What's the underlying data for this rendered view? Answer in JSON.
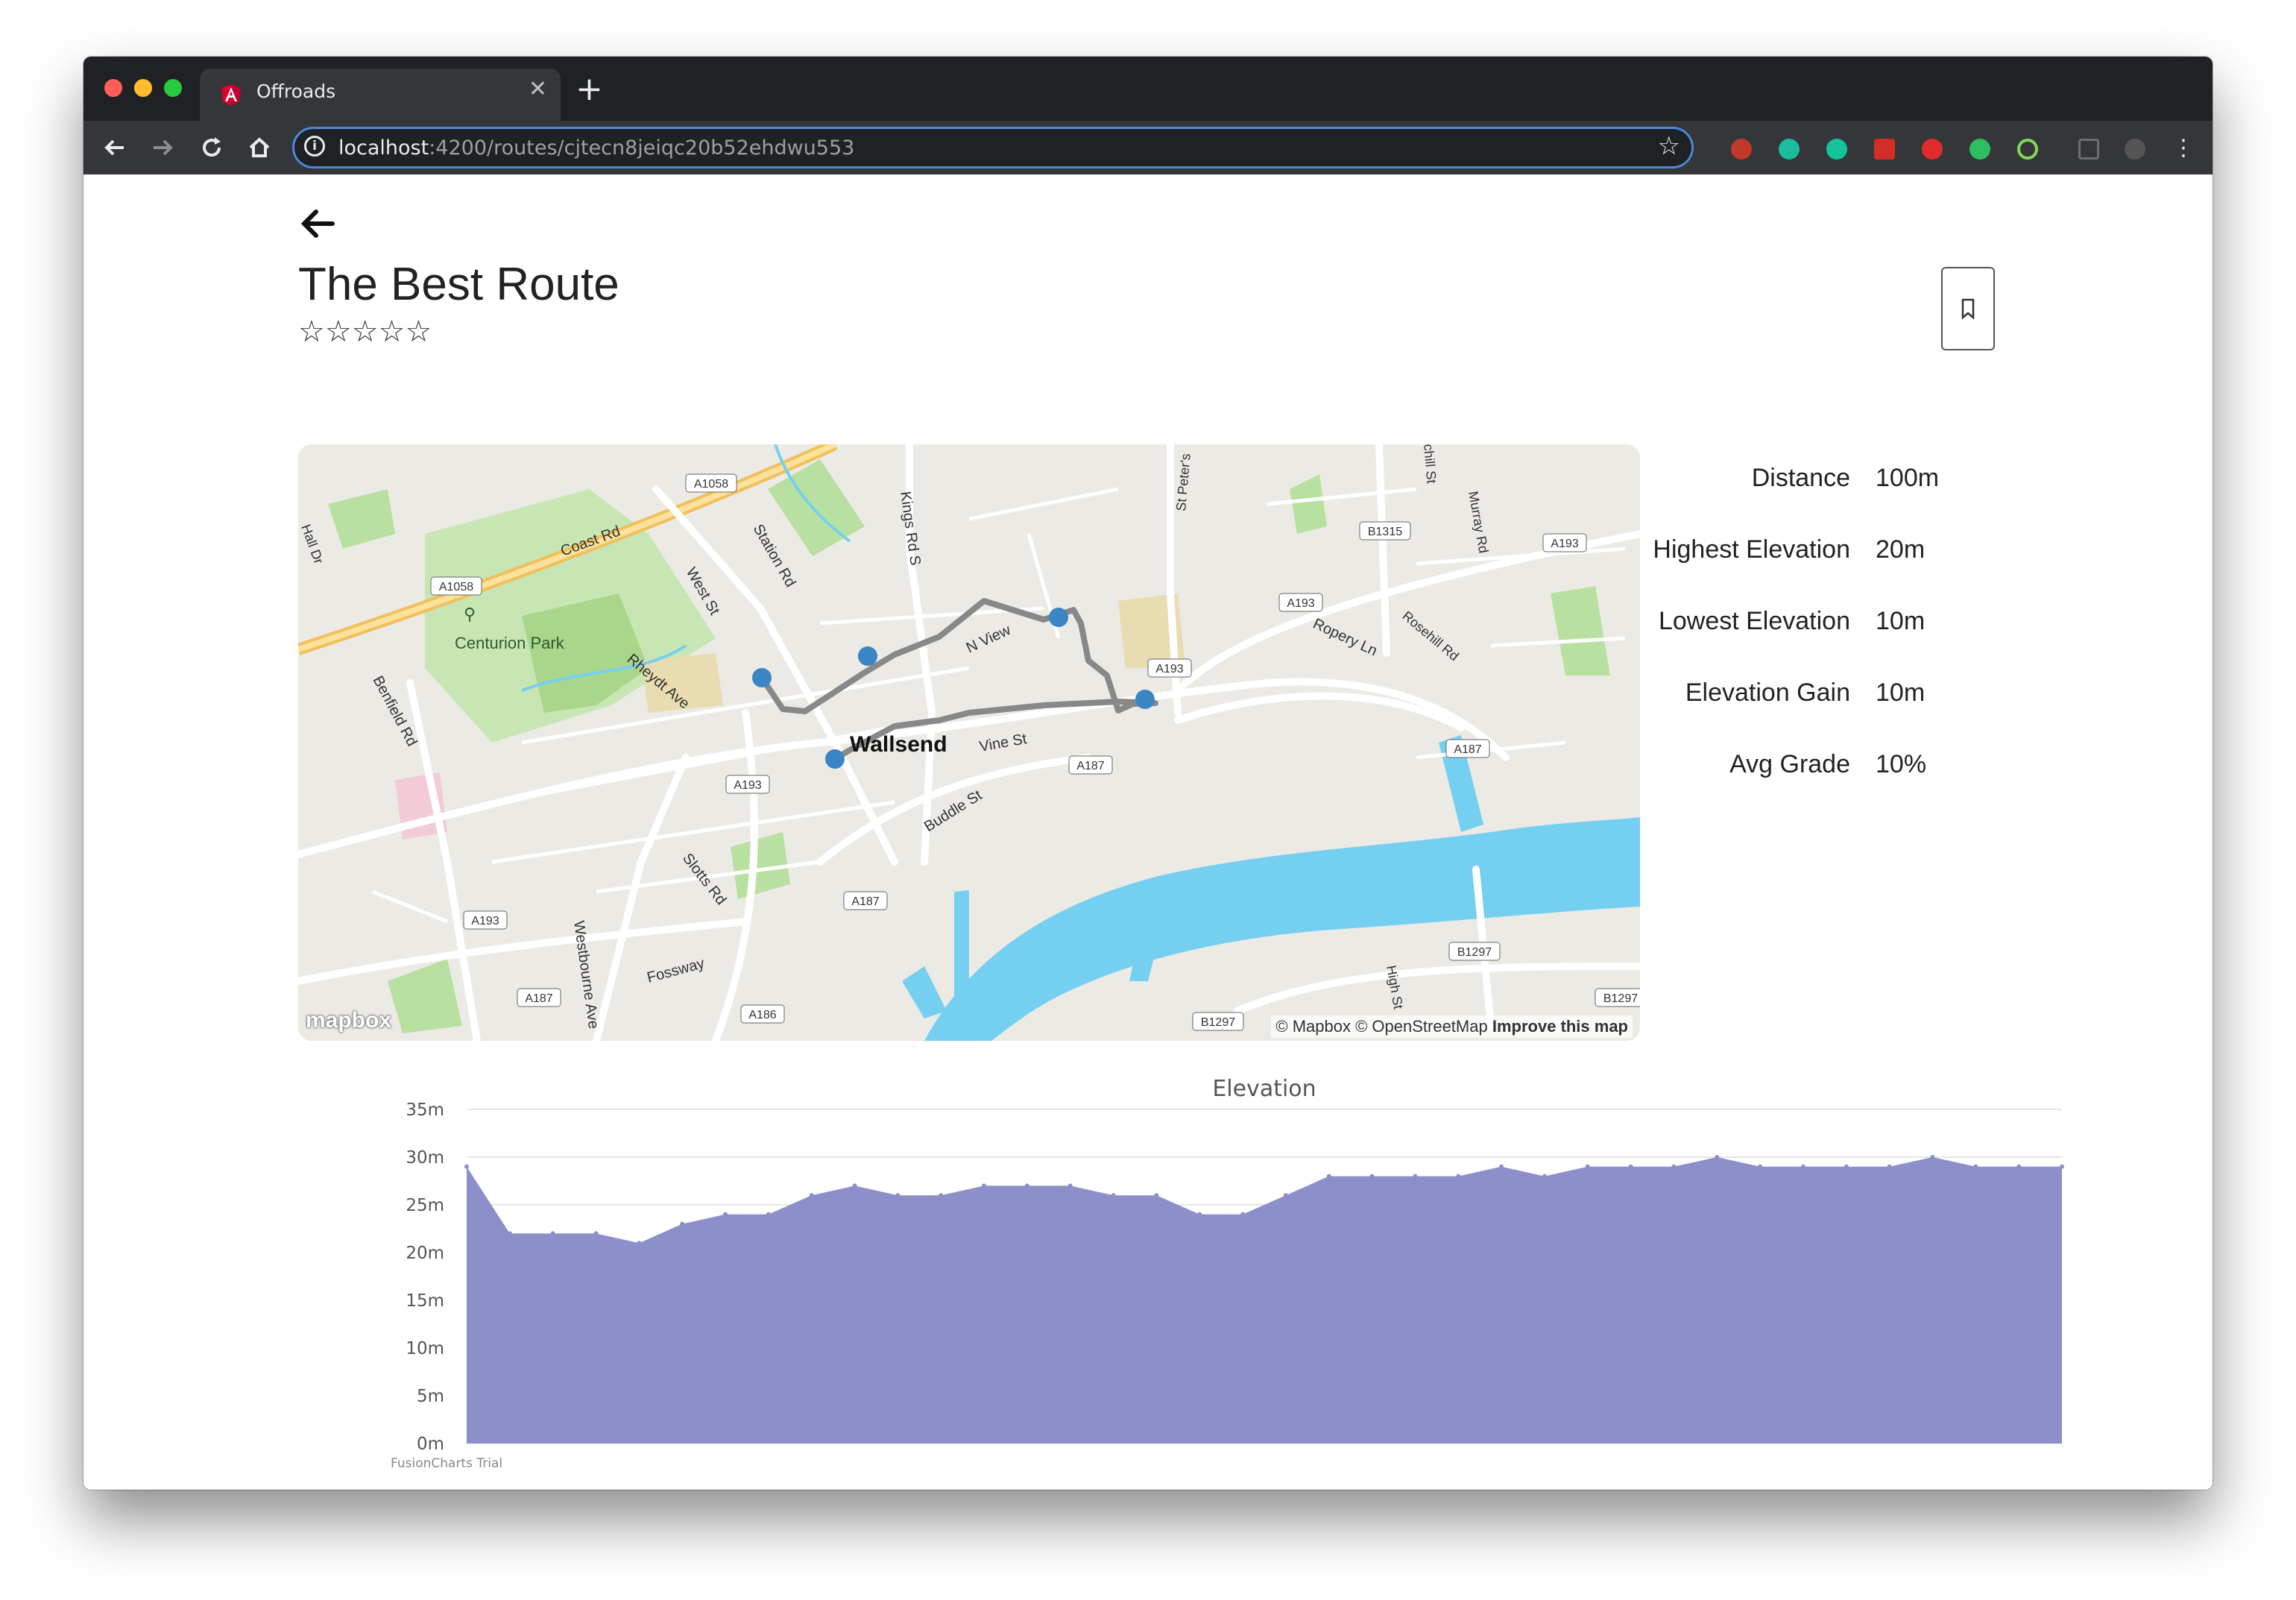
{
  "browser": {
    "tab_title": "Offroads",
    "url_host": "localhost",
    "url_rest": ":4200/routes/cjtecn8jeiqc20b52ehdwu553",
    "colors": {
      "close": "#ff5f57",
      "minimize": "#febc2e",
      "maximize": "#28c840",
      "tab_icon": "#dd0031"
    },
    "extensions": [
      "ghostery-icon",
      "mercury-icon",
      "grammarly-icon",
      "lastpass-icon",
      "vivaldi-icon",
      "evernote-icon",
      "target-icon",
      "cast-icon",
      "avatar"
    ]
  },
  "page": {
    "title": "The Best Route",
    "rating_stars": [
      "☆",
      "☆",
      "☆",
      "☆",
      "☆"
    ],
    "rating_value": 0,
    "rating_max": 5
  },
  "map": {
    "place_label": "Wallsend",
    "park_label": "Centurion Park",
    "road_labels": {
      "coast_rd": "Coast Rd",
      "station_rd": "Station Rd",
      "kings_rd": "Kings Rd S",
      "west_st": "West St",
      "n_view": "N View",
      "rheydt_ave": "Rheydt Ave",
      "vine_st": "Vine St",
      "buddle_st": "Buddle St",
      "benfield_rd": "Benfield Rd",
      "slotts_rd": "Slotts Rd",
      "fossway": "Fossway",
      "westbourne_ave": "Westbourne Ave",
      "ropery_ln": "Ropery Ln",
      "rosehill_rd": "Rosehill Rd",
      "murray_rd": "Murray Rd",
      "st_peters": "St Peter's",
      "high_st": "High St",
      "churchill_st": "chill St",
      "hall_dr": "Hall Dr"
    },
    "shields": {
      "a1058_top": "A1058",
      "a1058_left": "A1058",
      "a193_1": "A193",
      "a193_2": "A193",
      "a193_3": "A193",
      "a193_4": "A193",
      "a193_5": "A193",
      "a187_1": "A187",
      "a187_2": "A187",
      "a187_3": "A187",
      "a187_4": "A187",
      "a186": "A186",
      "b1315": "B1315",
      "b1297_1": "B1297",
      "b1297_2": "B1297",
      "b1297_3": "B1297"
    },
    "attribution_text": "© Mapbox © OpenStreetMap",
    "improve_link": "Improve this map",
    "logo_text": "mapbox",
    "route_color": "#888888",
    "waypoint_color": "#3a85c4"
  },
  "stats": {
    "distance_label": "Distance",
    "distance_value": "100m",
    "highest_label": "Highest Elevation",
    "highest_value": "20m",
    "lowest_label": "Lowest Elevation",
    "lowest_value": "10m",
    "gain_label": "Elevation Gain",
    "gain_value": "10m",
    "grade_label": "Avg Grade",
    "grade_value": "10%"
  },
  "chart_data": {
    "type": "area",
    "title": "Elevation",
    "xlabel": "",
    "ylabel": "",
    "ylim": [
      0,
      35
    ],
    "yticks": [
      "0m",
      "5m",
      "10m",
      "15m",
      "20m",
      "25m",
      "30m",
      "35m"
    ],
    "grid": true,
    "color": "#8c8fc9",
    "values": [
      29,
      22,
      22,
      22,
      21,
      23,
      24,
      24,
      26,
      27,
      26,
      26,
      27,
      27,
      27,
      26,
      26,
      24,
      24,
      26,
      28,
      28,
      28,
      28,
      29,
      28,
      29,
      29,
      29,
      30,
      29,
      29,
      29,
      29,
      30,
      29,
      29,
      29
    ],
    "credit": "FusionCharts Trial"
  }
}
